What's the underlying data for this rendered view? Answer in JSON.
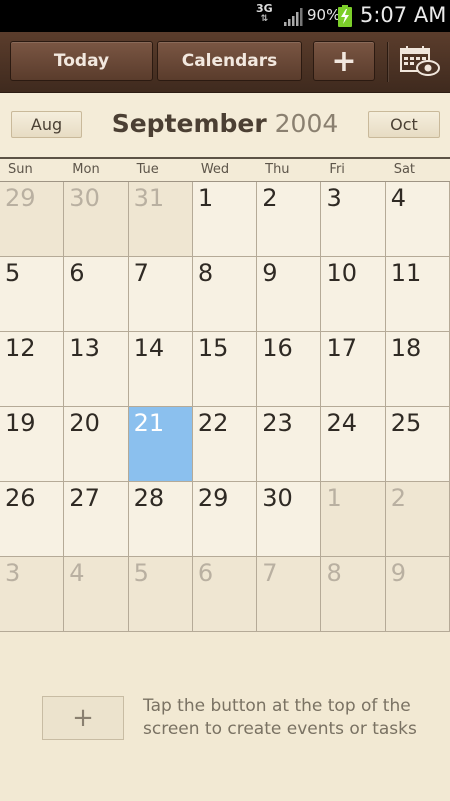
{
  "status_bar": {
    "network": "3G",
    "battery_percent": "90%",
    "time": "5:07 AM"
  },
  "toolbar": {
    "today_label": "Today",
    "calendars_label": "Calendars",
    "add_label": "+",
    "view_icon": "calendar-eye-icon"
  },
  "month_header": {
    "prev_label": "Aug",
    "next_label": "Oct",
    "month": "September",
    "year": "2004"
  },
  "weekdays": [
    "Sun",
    "Mon",
    "Tue",
    "Wed",
    "Thu",
    "Fri",
    "Sat"
  ],
  "weeks": [
    [
      {
        "d": "29",
        "other": true
      },
      {
        "d": "30",
        "other": true
      },
      {
        "d": "31",
        "other": true
      },
      {
        "d": "1"
      },
      {
        "d": "2"
      },
      {
        "d": "3"
      },
      {
        "d": "4"
      }
    ],
    [
      {
        "d": "5"
      },
      {
        "d": "6"
      },
      {
        "d": "7"
      },
      {
        "d": "8"
      },
      {
        "d": "9"
      },
      {
        "d": "10"
      },
      {
        "d": "11"
      }
    ],
    [
      {
        "d": "12"
      },
      {
        "d": "13"
      },
      {
        "d": "14"
      },
      {
        "d": "15"
      },
      {
        "d": "16"
      },
      {
        "d": "17"
      },
      {
        "d": "18"
      }
    ],
    [
      {
        "d": "19"
      },
      {
        "d": "20"
      },
      {
        "d": "21",
        "selected": true
      },
      {
        "d": "22"
      },
      {
        "d": "23"
      },
      {
        "d": "24"
      },
      {
        "d": "25"
      }
    ],
    [
      {
        "d": "26"
      },
      {
        "d": "27"
      },
      {
        "d": "28"
      },
      {
        "d": "29"
      },
      {
        "d": "30"
      },
      {
        "d": "1",
        "other": true
      },
      {
        "d": "2",
        "other": true
      }
    ],
    [
      {
        "d": "3",
        "other": true
      },
      {
        "d": "4",
        "other": true
      },
      {
        "d": "5",
        "other": true
      },
      {
        "d": "6",
        "other": true
      },
      {
        "d": "7",
        "other": true
      },
      {
        "d": "8",
        "other": true
      },
      {
        "d": "9",
        "other": true
      }
    ]
  ],
  "bottom": {
    "add_label": "+",
    "hint_line1": "Tap the button at the top of the",
    "hint_line2": "screen to create events or tasks"
  },
  "colors": {
    "selected_day": "#8bc0ee",
    "toolbar": "#4a3224",
    "background": "#f3ecd9"
  }
}
